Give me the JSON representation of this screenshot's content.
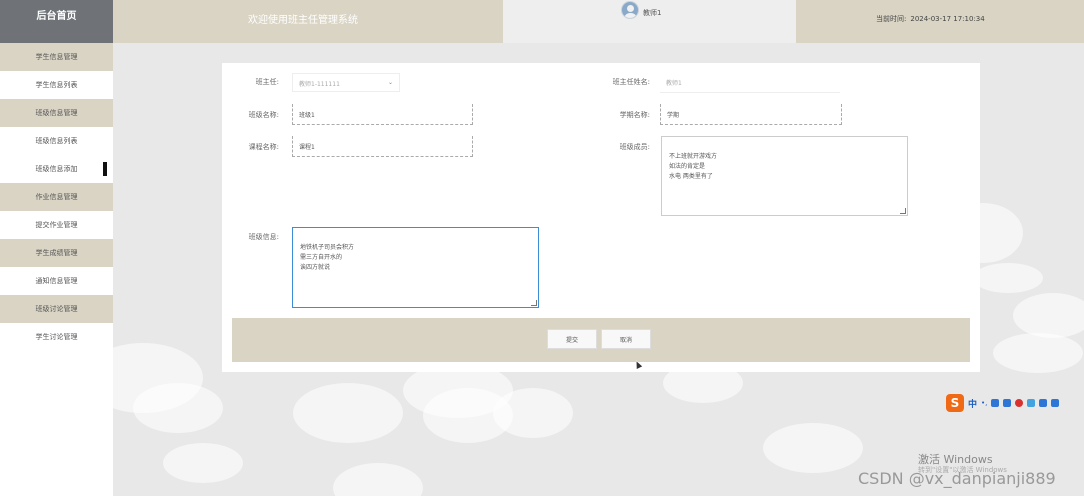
{
  "header": {
    "home_title": "后台首页",
    "welcome": "欢迎使用班主任管理系统",
    "username": "教师1",
    "time_label": "当前时间:",
    "time_value": "2024-03-17 17:10:34"
  },
  "sidebar": {
    "items": [
      {
        "label": "学生信息管理",
        "type": "group"
      },
      {
        "label": "学生信息列表",
        "type": "sub"
      },
      {
        "label": "班级信息管理",
        "type": "group"
      },
      {
        "label": "班级信息列表",
        "type": "sub"
      },
      {
        "label": "班级信息添加",
        "type": "sub",
        "active": true
      },
      {
        "label": "作业信息管理",
        "type": "group"
      },
      {
        "label": "提交作业管理",
        "type": "sub"
      },
      {
        "label": "学生成绩管理",
        "type": "group"
      },
      {
        "label": "通知信息管理",
        "type": "sub"
      },
      {
        "label": "班级讨论管理",
        "type": "group"
      },
      {
        "label": "学生讨论管理",
        "type": "sub"
      }
    ]
  },
  "form": {
    "teacher_label": "班主任:",
    "teacher_value": "教师1-111111",
    "teacher_name_label": "班主任姓名:",
    "teacher_name_value": "教师1",
    "class_name_label": "班级名称:",
    "class_name_value": "班级1",
    "semester_label": "学期名称:",
    "semester_value": "学期",
    "course_label": "课程名称:",
    "course_value": "课程1",
    "members_label": "班级成员:",
    "members_value": "不上班就开游戏方\n如法的肯定是\n水电 两类里有了",
    "info_label": "班级信息:",
    "info_value": "地铁机子司员会积方\n需三方自开水的\n诶四方就说",
    "submit_label": "提交",
    "cancel_label": "取消"
  },
  "ime": {
    "logo": "S",
    "mode": "中",
    "punct": "•,"
  },
  "watermark": {
    "windows": "激活 Windows",
    "windows_sub": "转到\"设置\"以激活 Windows",
    "csdn": "CSDN @vx_danpianji889"
  },
  "colors": {
    "header_beige": "#d9d4c4",
    "header_gray": "#6f7378",
    "focus_blue": "#3c8dd8"
  }
}
